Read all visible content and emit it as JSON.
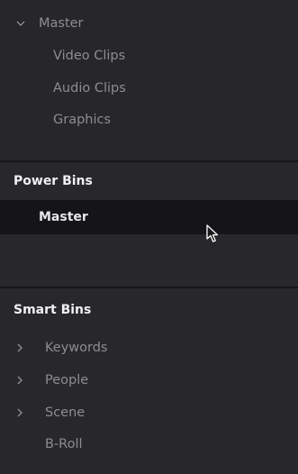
{
  "master_bins": {
    "root_label": "Master",
    "children": [
      {
        "label": "Video Clips"
      },
      {
        "label": "Audio Clips"
      },
      {
        "label": "Graphics"
      }
    ]
  },
  "power_bins": {
    "header": "Power Bins",
    "items": [
      {
        "label": "Master",
        "selected": true
      }
    ]
  },
  "smart_bins": {
    "header": "Smart Bins",
    "items": [
      {
        "label": "Keywords",
        "expandable": true
      },
      {
        "label": "People",
        "expandable": true
      },
      {
        "label": "Scene",
        "expandable": true
      },
      {
        "label": "B-Roll",
        "expandable": false
      }
    ]
  },
  "colors": {
    "panel_bg": "#28282b",
    "selected_bg": "#151517",
    "text_muted": "#8d8d91",
    "text_bright": "#f0f0f2"
  }
}
